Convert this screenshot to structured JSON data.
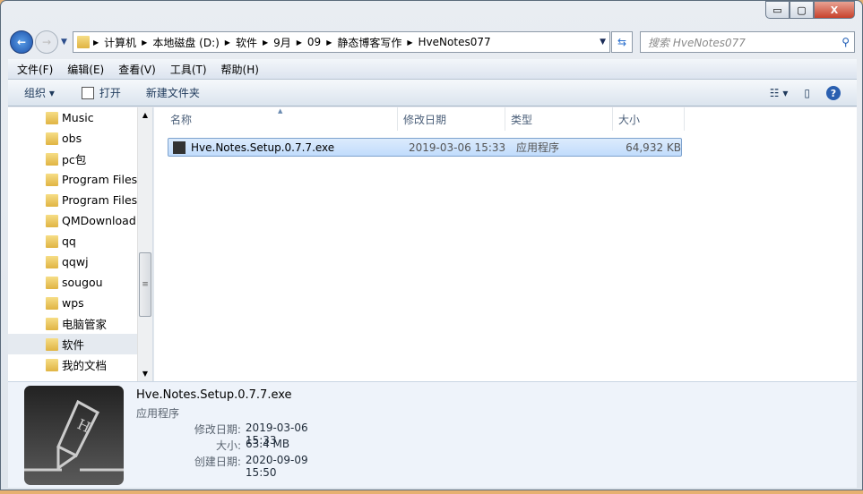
{
  "window": {
    "minimize": "▭",
    "maximize": "▢",
    "close": "X"
  },
  "address": {
    "crumbs": [
      "计算机",
      "本地磁盘 (D:)",
      "软件",
      "9月",
      "09",
      "静态博客写作",
      "HveNotes077"
    ]
  },
  "search": {
    "placeholder": "搜索 HveNotes077"
  },
  "menu": [
    "文件(F)",
    "编辑(E)",
    "查看(V)",
    "工具(T)",
    "帮助(H)"
  ],
  "toolbar": {
    "organize": "组织 ▾",
    "open": "打开",
    "new_folder": "新建文件夹"
  },
  "sidebar": {
    "items": [
      "Music",
      "obs",
      "pc包",
      "Program Files",
      "Program Files",
      "QMDownload",
      "qq",
      "qqwj",
      "sougou",
      "wps",
      "电脑管家",
      "软件",
      "我的文档"
    ],
    "selected": "软件"
  },
  "columns": [
    "名称",
    "修改日期",
    "类型",
    "大小"
  ],
  "files": [
    {
      "name": "Hve.Notes.Setup.0.7.7.exe",
      "modified": "2019-03-06 15:33",
      "type": "应用程序",
      "size": "64,932 KB"
    }
  ],
  "details": {
    "name": "Hve.Notes.Setup.0.7.7.exe",
    "type": "应用程序",
    "props": [
      {
        "k": "修改日期:",
        "v": "2019-03-06 15:33"
      },
      {
        "k": "大小:",
        "v": "63.4 MB"
      },
      {
        "k": "创建日期:",
        "v": "2020-09-09 15:50"
      }
    ],
    "icon_letter": "H"
  }
}
